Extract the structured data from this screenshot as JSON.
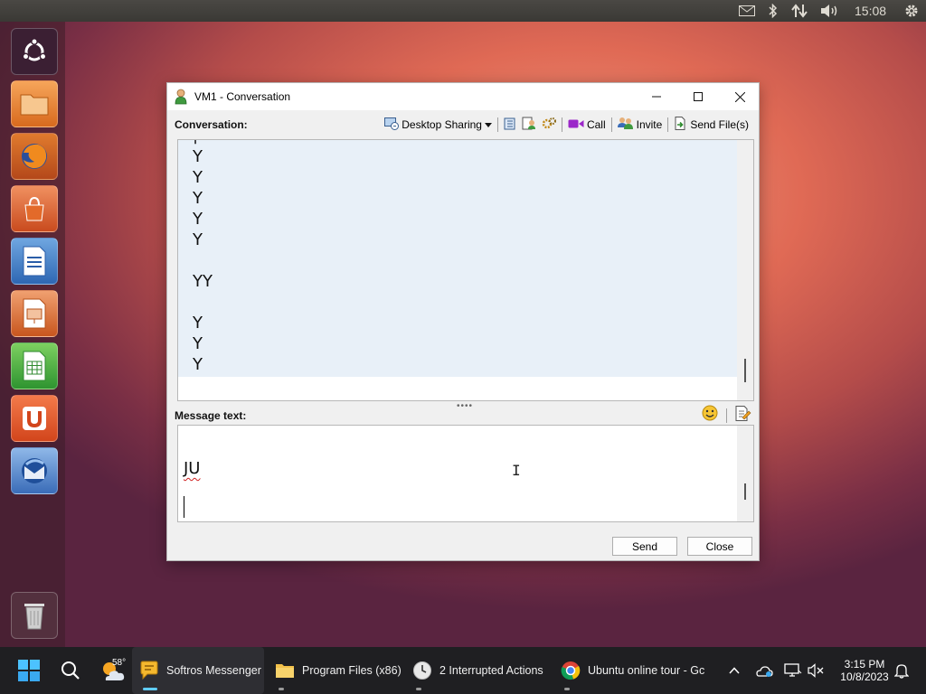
{
  "top_panel": {
    "clock": "15:08",
    "icons": [
      "mail-icon",
      "bluetooth-icon",
      "network-icon",
      "volume-icon",
      "settings-gear-icon"
    ]
  },
  "launcher": {
    "items": [
      "ubuntu-dash",
      "files",
      "firefox",
      "software-center",
      "writer",
      "impress",
      "calc",
      "ubuntu-one",
      "thunderbird",
      "trash"
    ]
  },
  "window": {
    "title": "VM1 - Conversation",
    "conversation_label": "Conversation:",
    "toolbar": {
      "desktop_sharing": "Desktop Sharing",
      "call": "Call",
      "invite": "Invite",
      "send_files": "Send File(s)"
    },
    "conversation_lines": [
      "Y",
      "Y",
      "Y",
      "Y",
      "Y",
      "",
      "YY",
      "",
      "Y",
      "Y",
      "Y"
    ],
    "message_label": "Message text:",
    "message_text": "JU",
    "send_button": "Send",
    "close_button": "Close"
  },
  "taskbar": {
    "weather_temp": "58°",
    "apps": [
      {
        "label": "Softros Messenger",
        "active": true
      },
      {
        "label": "Program Files (x86)",
        "active": false
      },
      {
        "label": "2 Interrupted Actions",
        "active": false
      },
      {
        "label": "Ubuntu online tour - Gc",
        "active": false
      }
    ],
    "time": "3:15 PM",
    "date": "10/8/2023"
  },
  "colors": {
    "accent": "#60cdff",
    "conv_bg": "#e8f0f8",
    "taskbar_bg": "#1f1f22"
  }
}
